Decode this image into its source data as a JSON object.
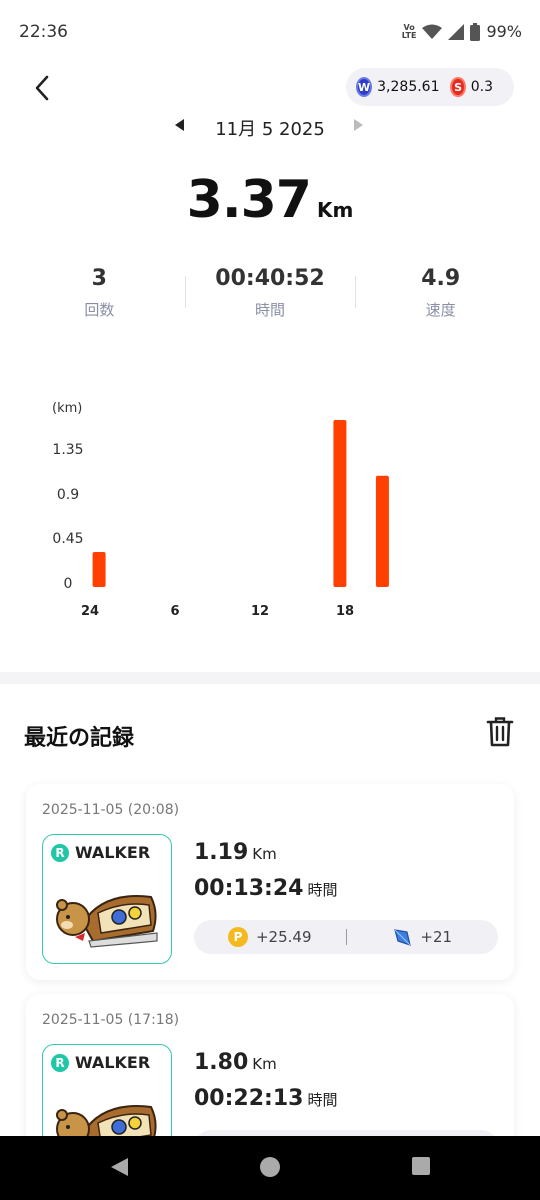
{
  "status": {
    "time": "22:36",
    "volte": "VoLTE",
    "battery": "99%"
  },
  "header": {
    "wallet_balance": "3,285.61",
    "token_balance": "0.3",
    "date": "11月 5 2025"
  },
  "summary": {
    "distance": "3.37",
    "distance_unit": "Km",
    "stats": [
      {
        "value": "3",
        "label": "回数"
      },
      {
        "value": "00:40:52",
        "label": "時間"
      },
      {
        "value": "4.9",
        "label": "速度"
      }
    ]
  },
  "chart_data": {
    "type": "bar",
    "ylabel": "(km)",
    "y_ticks": [
      "0",
      "0.45",
      "0.9",
      "1.35"
    ],
    "ylim": [
      0,
      1.6
    ],
    "x_ticks": [
      "24",
      "6",
      "12",
      "18"
    ],
    "xlim": [
      0,
      24
    ],
    "bars": [
      {
        "hour": 0.5,
        "value": 0.32
      },
      {
        "hour": 17.5,
        "value": 1.6
      },
      {
        "hour": 20.5,
        "value": 1.06
      }
    ],
    "bar_color": "#ff4000",
    "grid": false
  },
  "records": {
    "title": "最近の記録",
    "items": [
      {
        "datetime": "2025-11-05 (20:08)",
        "brand": "WALKER",
        "distance": "1.19",
        "distance_unit": "Km",
        "duration": "00:13:24",
        "duration_unit": "時間",
        "points": "+25.49",
        "gems": "+21"
      },
      {
        "datetime": "2025-11-05 (17:18)",
        "brand": "WALKER",
        "distance": "1.80",
        "distance_unit": "Km",
        "duration": "00:22:13",
        "duration_unit": "時間",
        "points": "",
        "gems": ""
      }
    ]
  },
  "colors": {
    "accent_bar": "#ff4000",
    "teal": "#35c8b0"
  }
}
